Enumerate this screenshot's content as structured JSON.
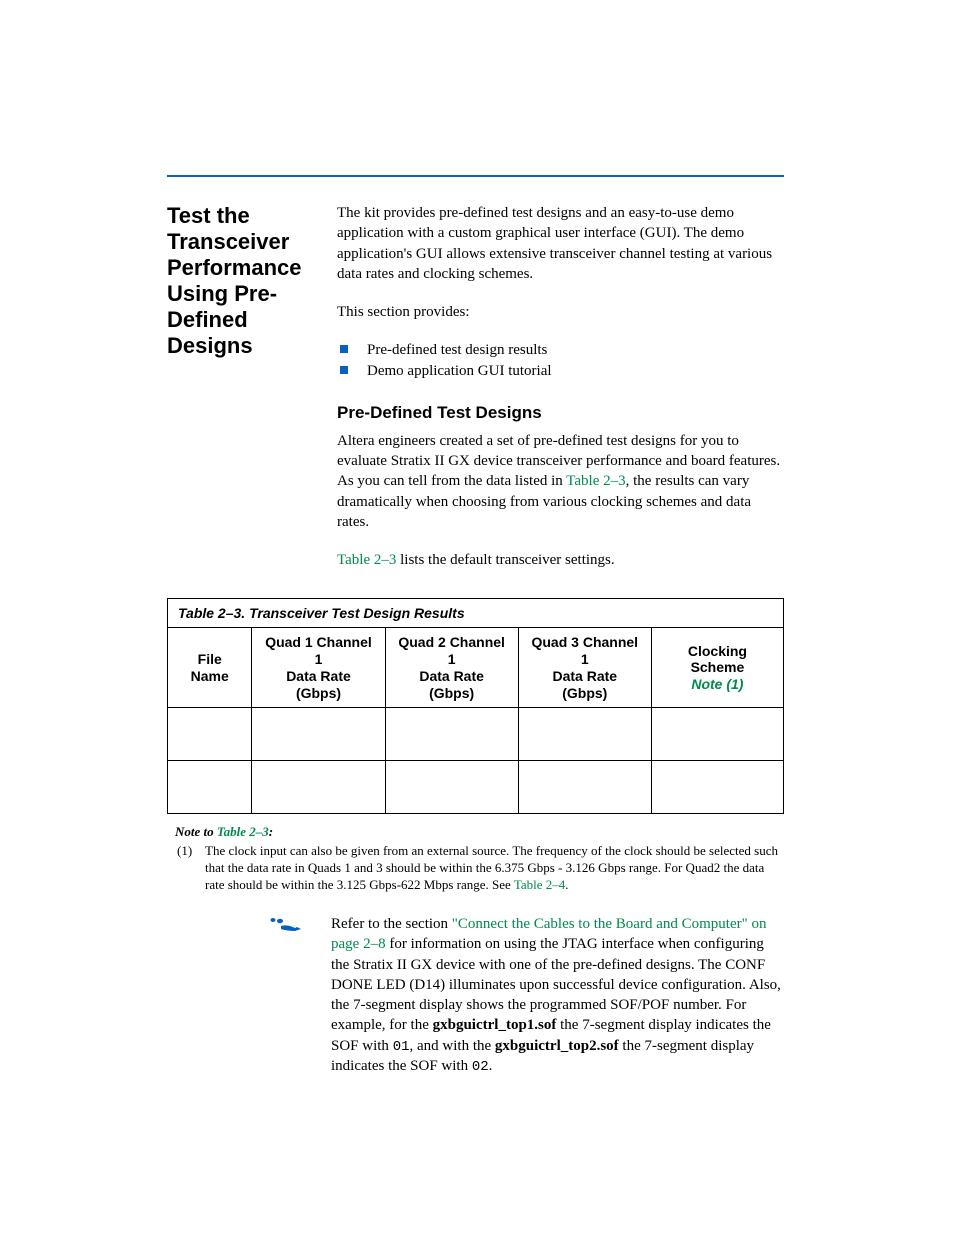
{
  "section_title": "Test the Transceiver Performance Using Pre-Defined Designs",
  "intro_para": "The kit provides pre-defined test designs and an easy-to-use demo application with a custom graphical user interface (GUI). The demo application's GUI allows extensive transceiver channel testing at various data rates and clocking schemes.",
  "provides_lead": "This section provides:",
  "bullets": [
    "Pre-defined test design results",
    "Demo application GUI tutorial"
  ],
  "sub_heading": "Pre-Defined Test Designs",
  "sub_para_a": "Altera engineers created a set of pre-defined test designs for you to evaluate Stratix II GX device transceiver performance and board features. As you can tell from the data listed in ",
  "table_ref_1": "Table 2–3",
  "sub_para_b": ", the results can vary dramatically when choosing from various clocking schemes and data rates.",
  "settings_a": "Table 2–3",
  "settings_b": " lists the default transceiver settings.",
  "table": {
    "title": "Table 2–3. Transceiver Test Design Results",
    "headers": {
      "c1": "File Name",
      "c2a": "Quad 1 Channel 1",
      "c2b": "Data Rate (Gbps)",
      "c3a": "Quad 2 Channel 1",
      "c3b": "Data Rate (Gbps)",
      "c4a": "Quad 3 Channel 1",
      "c4b": "Data Rate (Gbps)",
      "c5a": "Clocking Scheme",
      "c5b": "Note (1)"
    }
  },
  "note": {
    "label_a": "Note to ",
    "label_link": "Table 2–3",
    "label_b": ":",
    "num": "(1)",
    "text_a": "The clock input can also be given from an external source. The frequency of the clock should be selected such that the data rate in Quads 1 and 3 should be within the 6.375 Gbps - 3.126 Gbps range. For Quad2 the data rate should be within the 3.125 Gbps-622 Mbps range. See ",
    "text_link": "Table 2–4",
    "text_b": "."
  },
  "ref": {
    "a": "Refer to the section ",
    "link": "\"Connect the Cables to the Board and Computer\" on page 2–8",
    "b": " for information on using the JTAG interface when configuring the Stratix II GX device with one of the pre-defined designs. The CONF DONE LED (D14) illuminates upon successful device configuration. Also, the 7-segment display shows the programmed SOF/POF number. For example, for the ",
    "file1": "gxbguictrl_top1.sof",
    "c": " the 7-segment display indicates the SOF with ",
    "code1": "01",
    "d": ", and with the ",
    "file2": "gxbguictrl_top2.sof",
    "e": " the 7-segment display indicates the SOF with ",
    "code2": "02",
    "f": "."
  }
}
